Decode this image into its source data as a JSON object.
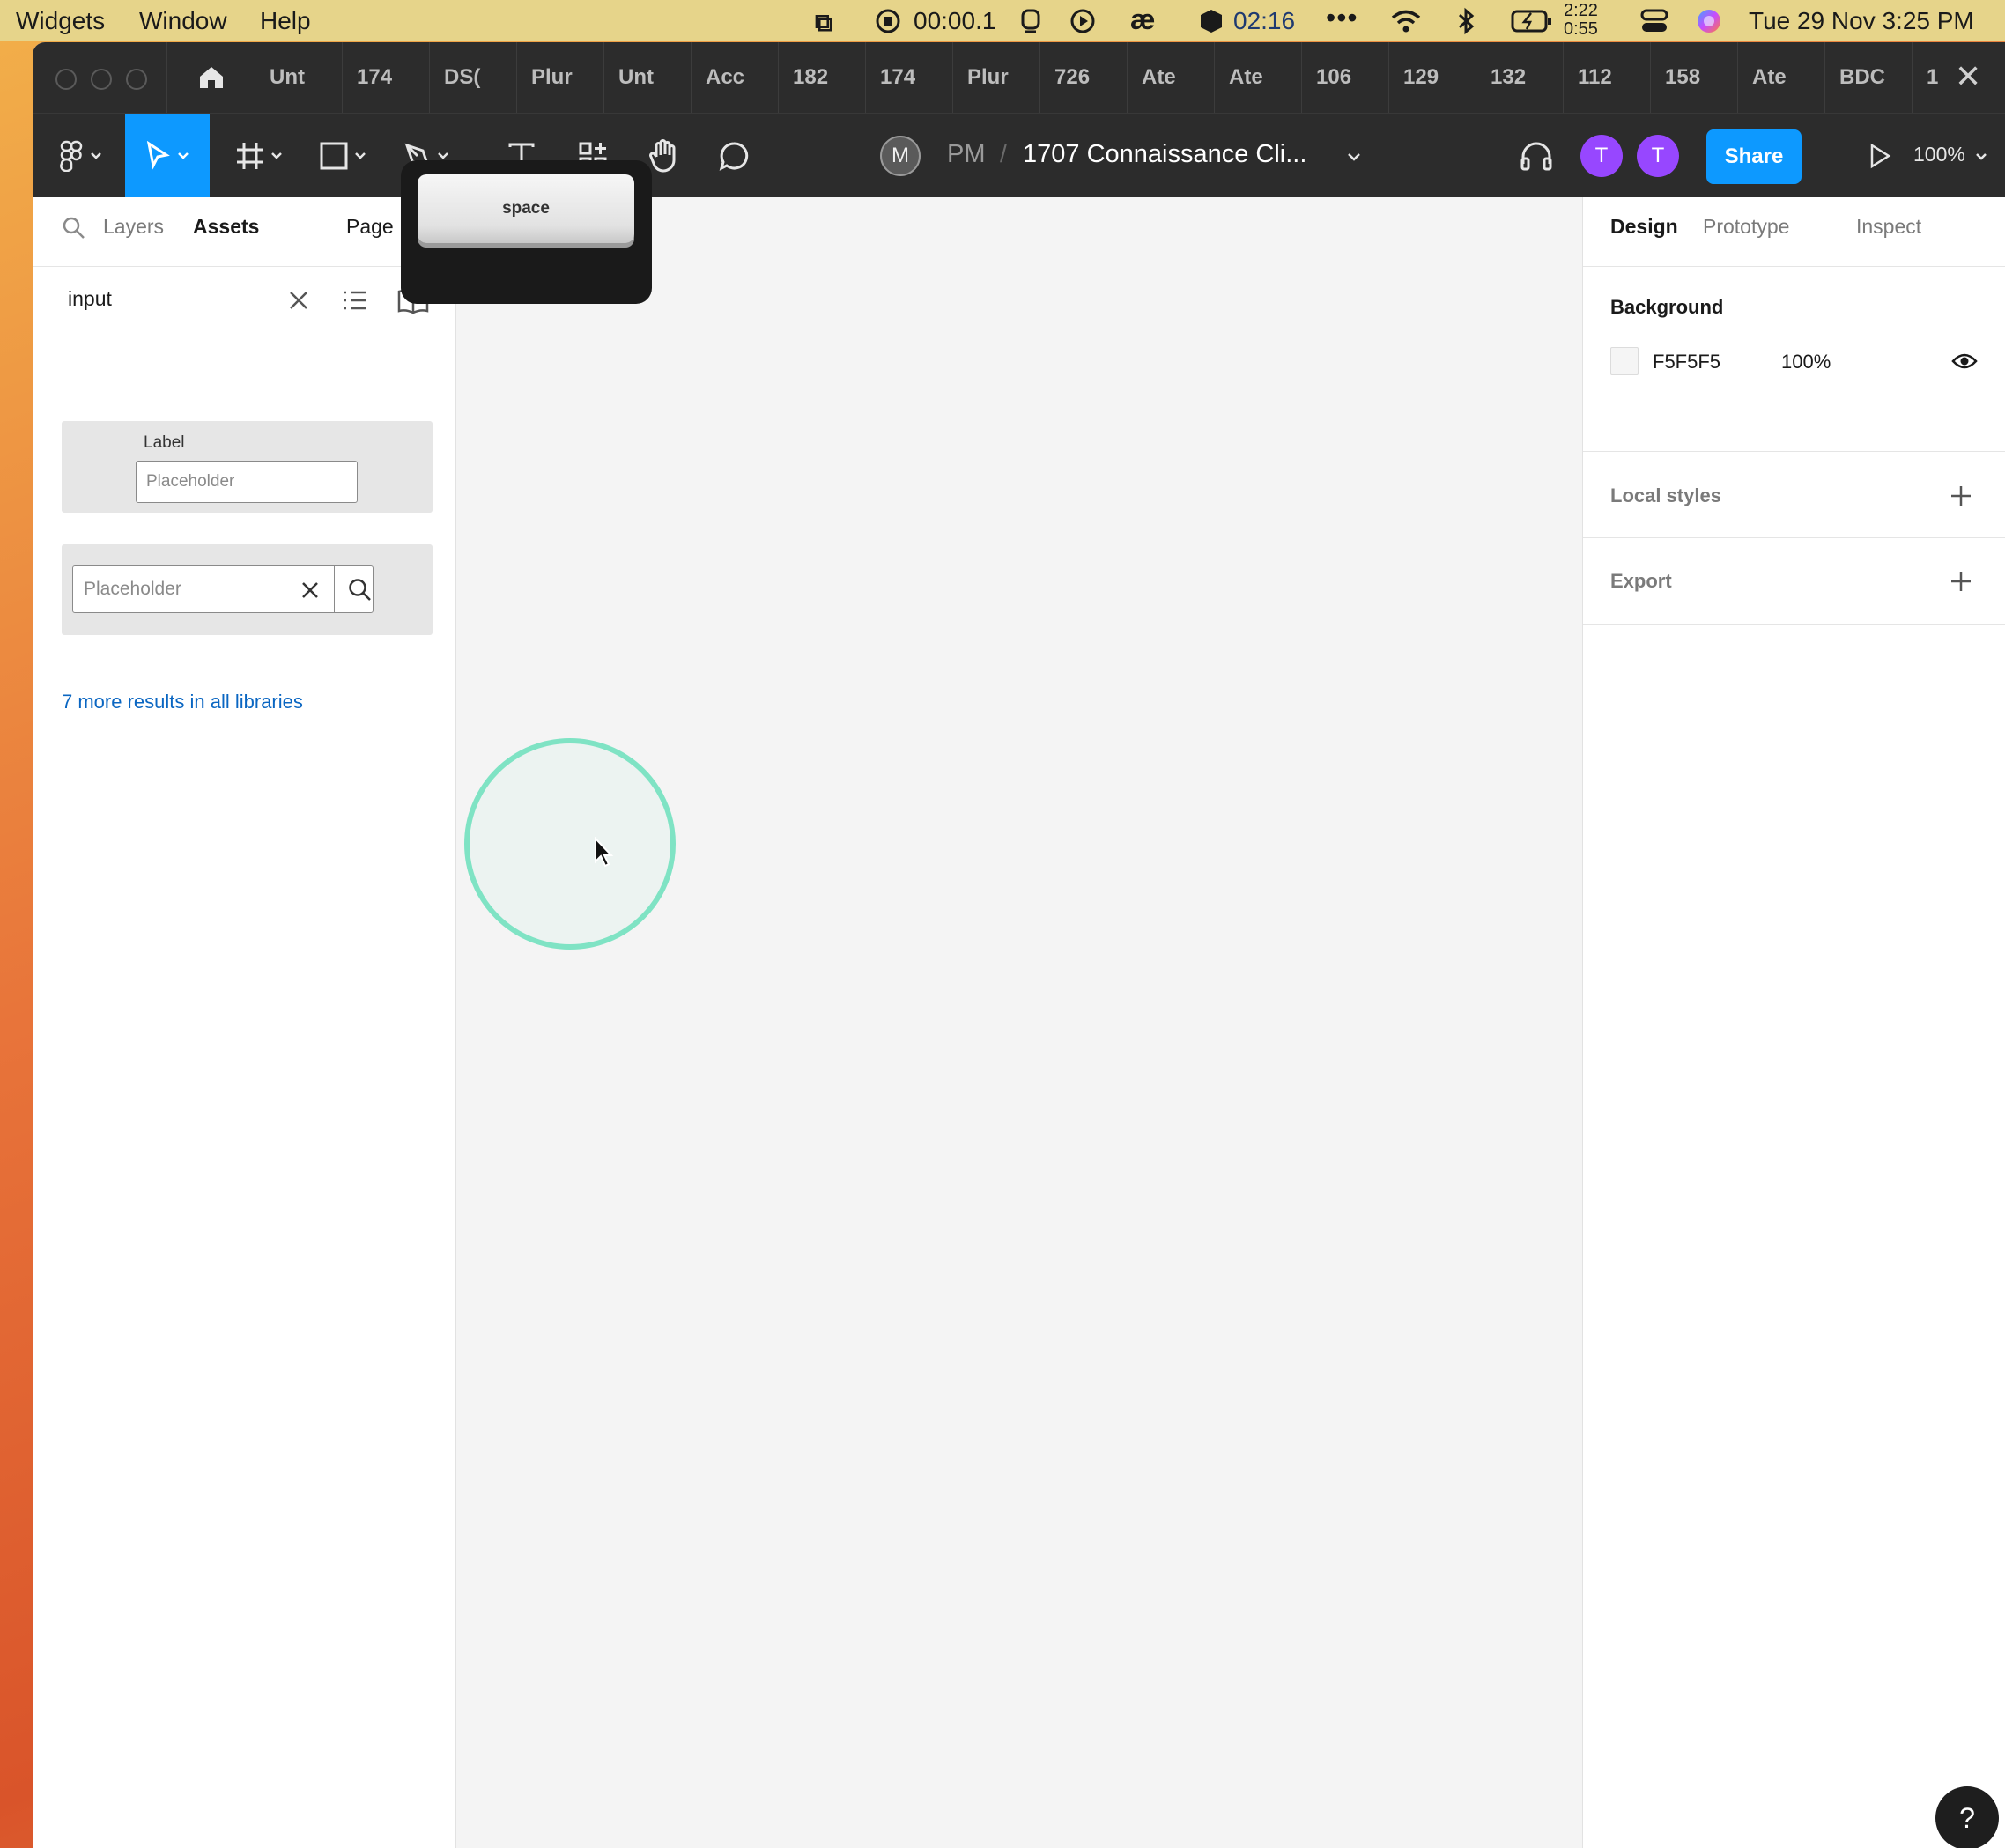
{
  "menubar": {
    "items": [
      "Widgets",
      "Window",
      "Help"
    ],
    "recording_time": "00:00.1",
    "timer_time": "02:16",
    "battery_time_top": "2:22",
    "battery_time_bottom": "0:55",
    "datetime": "Tue 29 Nov  3:25 PM"
  },
  "tabs": [
    "Unt",
    "174",
    "DS(",
    "Plur",
    "Unt",
    "Acc",
    "182",
    "174",
    "Plur",
    "726",
    "Ate",
    "Ate",
    "106",
    "129",
    "132",
    "112",
    "158",
    "Ate",
    "BDC",
    "1"
  ],
  "toolbar": {
    "avatar_initial": "M",
    "breadcrumb_team": "PM",
    "breadcrumb_sep": "/",
    "file_title": "1707 Connaissance Cli...",
    "user_avatars": [
      "T",
      "T"
    ],
    "share_label": "Share",
    "zoom": "100%",
    "key_overlay": "space"
  },
  "left_panel": {
    "tabs": [
      "Layers",
      "Assets",
      "Page"
    ],
    "search_value": "input",
    "asset1": {
      "label": "Label",
      "placeholder": "Placeholder"
    },
    "asset2": {
      "placeholder": "Placeholder"
    },
    "more_results": "7 more results in all libraries"
  },
  "right_panel": {
    "tabs": [
      "Design",
      "Prototype",
      "Inspect"
    ],
    "background_title": "Background",
    "bg_hex": "F5F5F5",
    "bg_opacity": "100%",
    "local_styles": "Local styles",
    "export": "Export"
  },
  "help_label": "?",
  "colors": {
    "accent": "#0d99ff",
    "avatar": "#9747ff",
    "link": "#0a66c2",
    "click_ring": "#7fe3c4"
  }
}
